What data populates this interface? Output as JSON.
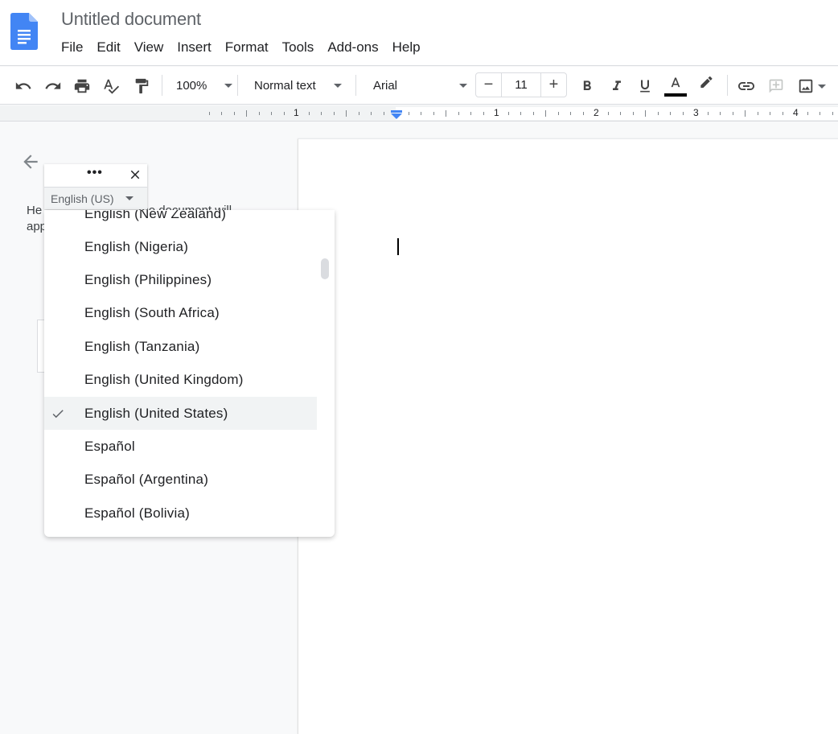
{
  "app": {
    "document_title": "Untitled document",
    "brand_color": "#4285f4"
  },
  "menu": [
    "File",
    "Edit",
    "View",
    "Insert",
    "Format",
    "Tools",
    "Add-ons",
    "Help"
  ],
  "toolbar": {
    "zoom": "100%",
    "paragraph_style": "Normal text",
    "font": "Arial",
    "font_size": "11",
    "decrease_label": "−",
    "increase_label": "+",
    "icons": [
      "undo-icon",
      "redo-icon",
      "print-icon",
      "spellcheck-icon",
      "paint-format-icon",
      "bold-icon",
      "italic-icon",
      "underline-icon",
      "text-color-icon",
      "highlight-icon",
      "link-icon",
      "add-comment-icon",
      "insert-image-icon"
    ]
  },
  "ruler": {
    "labels": [
      "1",
      "1",
      "2",
      "3",
      "4"
    ]
  },
  "outline_panel": {
    "text_line1": "He",
    "text_line1_tail": "the document will",
    "text_line2": "app"
  },
  "language_widget": {
    "more_label": "•••",
    "current_language": "English (US)"
  },
  "language_dropdown": {
    "items": [
      {
        "label": "English (New Zealand)",
        "selected": false
      },
      {
        "label": "English (Nigeria)",
        "selected": false
      },
      {
        "label": "English (Philippines)",
        "selected": false
      },
      {
        "label": "English (South Africa)",
        "selected": false
      },
      {
        "label": "English (Tanzania)",
        "selected": false
      },
      {
        "label": "English (United Kingdom)",
        "selected": false
      },
      {
        "label": "English (United States)",
        "selected": true
      },
      {
        "label": "Español",
        "selected": false
      },
      {
        "label": "Español (Argentina)",
        "selected": false
      },
      {
        "label": "Español (Bolivia)",
        "selected": false
      }
    ]
  }
}
